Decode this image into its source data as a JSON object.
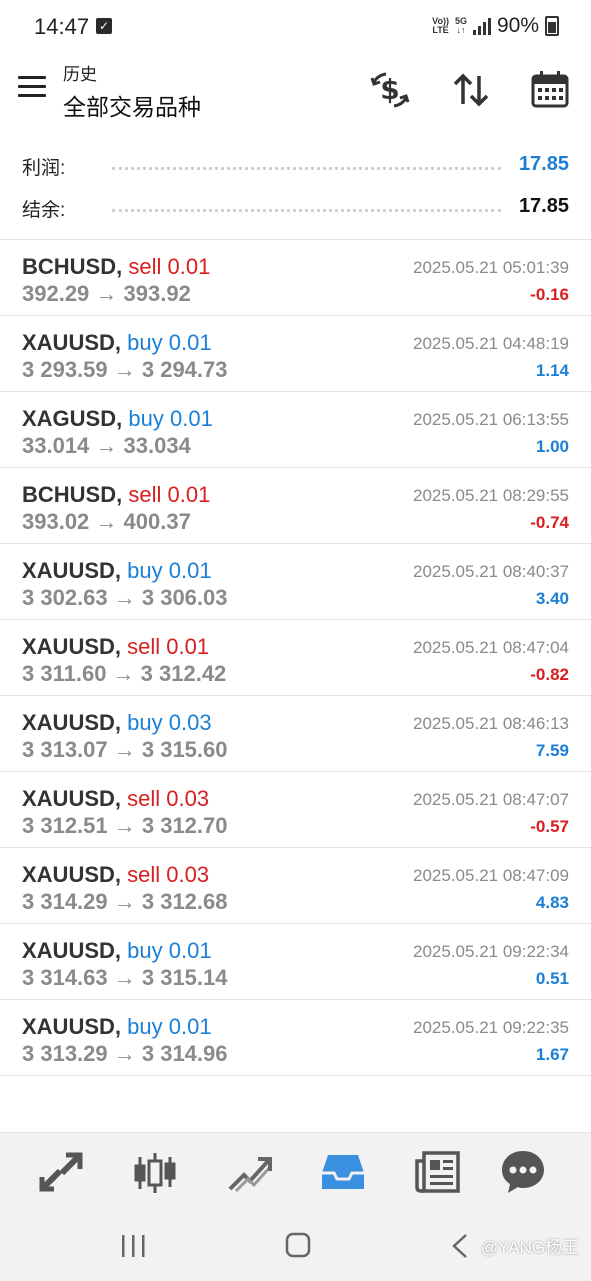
{
  "status": {
    "time": "14:47",
    "volte_top": "Vo))",
    "volte_bottom": "LTE",
    "net_top": "5G",
    "net_bottom": "↓↑",
    "battery": "90%"
  },
  "header": {
    "subtitle": "历史",
    "title": "全部交易品种"
  },
  "summary": [
    {
      "label": "利润:",
      "value": "17.85",
      "color": "blue"
    },
    {
      "label": "结余:",
      "value": "17.85",
      "color": "black"
    }
  ],
  "trades": [
    {
      "symbol": "BCHUSD,",
      "side": "sell",
      "volume": "0.01",
      "prices": "392.29 → 393.92",
      "time": "2025.05.21 05:01:39",
      "profit": "-0.16"
    },
    {
      "symbol": "XAUUSD,",
      "side": "buy",
      "volume": "0.01",
      "prices": "3 293.59 → 3 294.73",
      "time": "2025.05.21 04:48:19",
      "profit": "1.14"
    },
    {
      "symbol": "XAGUSD,",
      "side": "buy",
      "volume": "0.01",
      "prices": "33.014 → 33.034",
      "time": "2025.05.21 06:13:55",
      "profit": "1.00"
    },
    {
      "symbol": "BCHUSD,",
      "side": "sell",
      "volume": "0.01",
      "prices": "393.02 → 400.37",
      "time": "2025.05.21 08:29:55",
      "profit": "-0.74"
    },
    {
      "symbol": "XAUUSD,",
      "side": "buy",
      "volume": "0.01",
      "prices": "3 302.63 → 3 306.03",
      "time": "2025.05.21 08:40:37",
      "profit": "3.40"
    },
    {
      "symbol": "XAUUSD,",
      "side": "sell",
      "volume": "0.01",
      "prices": "3 311.60 → 3 312.42",
      "time": "2025.05.21 08:47:04",
      "profit": "-0.82"
    },
    {
      "symbol": "XAUUSD,",
      "side": "buy",
      "volume": "0.03",
      "prices": "3 313.07 → 3 315.60",
      "time": "2025.05.21 08:46:13",
      "profit": "7.59"
    },
    {
      "symbol": "XAUUSD,",
      "side": "sell",
      "volume": "0.03",
      "prices": "3 312.51 → 3 312.70",
      "time": "2025.05.21 08:47:07",
      "profit": "-0.57"
    },
    {
      "symbol": "XAUUSD,",
      "side": "sell",
      "volume": "0.03",
      "prices": "3 314.29 → 3 312.68",
      "time": "2025.05.21 08:47:09",
      "profit": "4.83"
    },
    {
      "symbol": "XAUUSD,",
      "side": "buy",
      "volume": "0.01",
      "prices": "3 314.63 → 3 315.14",
      "time": "2025.05.21 09:22:34",
      "profit": "0.51"
    },
    {
      "symbol": "XAUUSD,",
      "side": "buy",
      "volume": "0.01",
      "prices": "3 313.29 → 3 314.96",
      "time": "2025.05.21 09:22:35",
      "profit": "1.67"
    }
  ],
  "nav": [
    {
      "icon": "quotes-icon"
    },
    {
      "icon": "chart-candles-icon"
    },
    {
      "icon": "trade-icon"
    },
    {
      "icon": "history-inbox-icon",
      "active": true
    },
    {
      "icon": "news-icon"
    },
    {
      "icon": "chat-icon"
    }
  ],
  "watermark": "@YANG杨王",
  "colors": {
    "buy": "#1a7fd6",
    "sell": "#d81e1e",
    "active_nav": "#3b8fe0"
  }
}
